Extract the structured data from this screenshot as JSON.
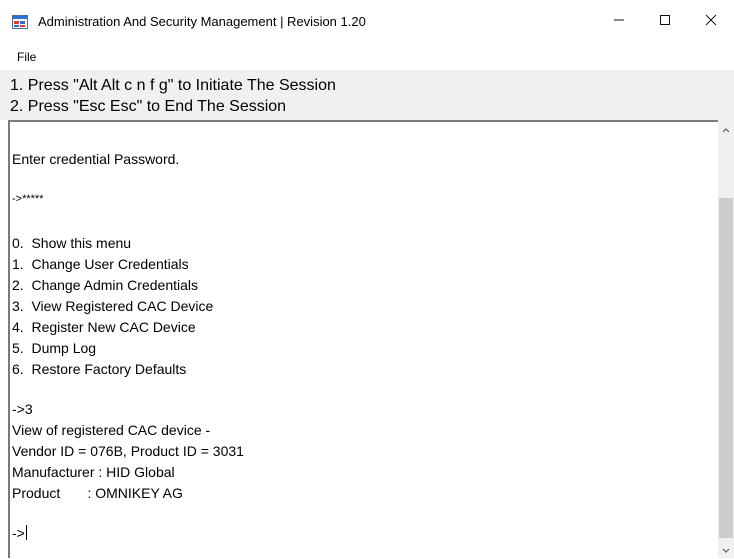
{
  "window": {
    "title": "Administration And Security Management  |  Revision 1.20",
    "icon": "app-window-icon",
    "controls": [
      "minimize-icon",
      "maximize-icon",
      "close-icon"
    ]
  },
  "menu": {
    "items": [
      {
        "label": "File"
      }
    ]
  },
  "instructions": {
    "line1": "1. Press \"Alt Alt c n f g\" to Initiate The Session",
    "line2": "2. Press \"Esc Esc\" to End The Session"
  },
  "console": {
    "lines": [
      "Enter credential Password.",
      "->*****",
      "0.  Show this menu",
      "1.  Change User Credentials",
      "2.  Change Admin Credentials",
      "3.  View Registered CAC Device",
      "4.  Register New CAC Device",
      "5.  Dump Log",
      "6.  Restore Factory Defaults",
      "->3",
      "View of registered CAC device -",
      "Vendor ID = 076B, Product ID = 3031",
      "Manufacturer : HID Global",
      "Product       : OMNIKEY AG",
      "->"
    ]
  },
  "colors": {
    "instructions_bg": "#f0f0f0",
    "scroll_thumb": "#cdcdcd",
    "frame_border": "#7a7a7a"
  }
}
